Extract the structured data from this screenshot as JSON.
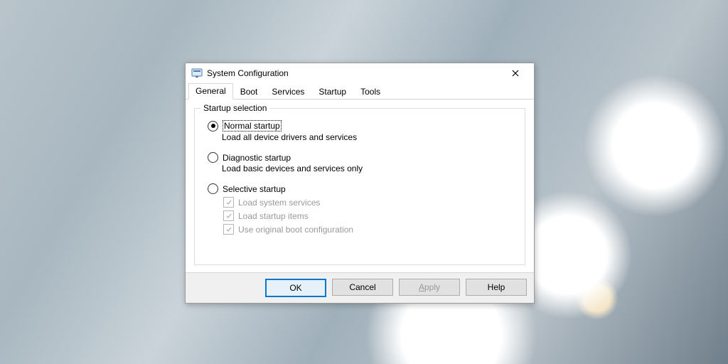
{
  "window": {
    "title": "System Configuration"
  },
  "tabs": {
    "general": "General",
    "boot": "Boot",
    "services": "Services",
    "startup": "Startup",
    "tools": "Tools"
  },
  "group": {
    "legend": "Startup selection",
    "normal": {
      "label": "Normal startup",
      "desc": "Load all device drivers and services"
    },
    "diagnostic": {
      "label": "Diagnostic startup",
      "desc": "Load basic devices and services only"
    },
    "selective": {
      "label": "Selective startup",
      "load_services": "Load system services",
      "load_startup": "Load startup items",
      "original_boot": "Use original boot configuration"
    }
  },
  "buttons": {
    "ok": "OK",
    "cancel": "Cancel",
    "apply_prefix": "A",
    "apply_suffix": "pply",
    "help": "Help"
  }
}
